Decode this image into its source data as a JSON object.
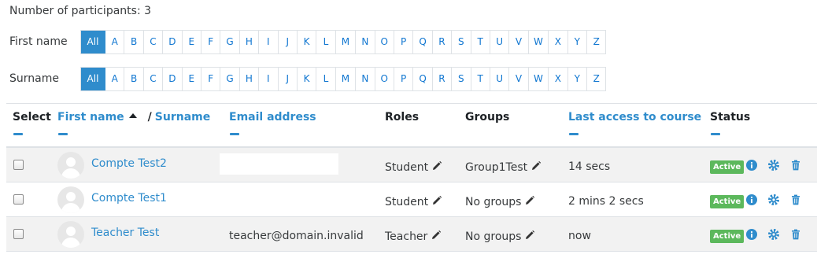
{
  "participants_count": "Number of participants: 3",
  "filters": {
    "first_name_label": "First name",
    "surname_label": "Surname",
    "all_label": "All",
    "letters": [
      "A",
      "B",
      "C",
      "D",
      "E",
      "F",
      "G",
      "H",
      "I",
      "J",
      "K",
      "L",
      "M",
      "N",
      "O",
      "P",
      "Q",
      "R",
      "S",
      "T",
      "U",
      "V",
      "W",
      "X",
      "Y",
      "Z"
    ]
  },
  "table": {
    "headers": {
      "select": "Select",
      "first_name": "First name",
      "separator": "/",
      "surname": "Surname",
      "email": "Email address",
      "roles": "Roles",
      "groups": "Groups",
      "last_access": "Last access to course",
      "status": "Status"
    },
    "rows": [
      {
        "name": "Compte Test2",
        "email": "",
        "role": "Student",
        "groups": "Group1Test",
        "last_access": "14 secs",
        "status": "Active"
      },
      {
        "name": "Compte Test1",
        "email": "",
        "role": "Student",
        "groups": "No groups",
        "last_access": "2 mins 2 secs",
        "status": "Active"
      },
      {
        "name": "Teacher Test",
        "email": "teacher@domain.invalid",
        "role": "Teacher",
        "groups": "No groups",
        "last_access": "now",
        "status": "Active"
      }
    ]
  },
  "colors": {
    "link": "#2f8ccc",
    "active_badge": "#5cb85c",
    "alt_row": "#f2f2f2"
  }
}
